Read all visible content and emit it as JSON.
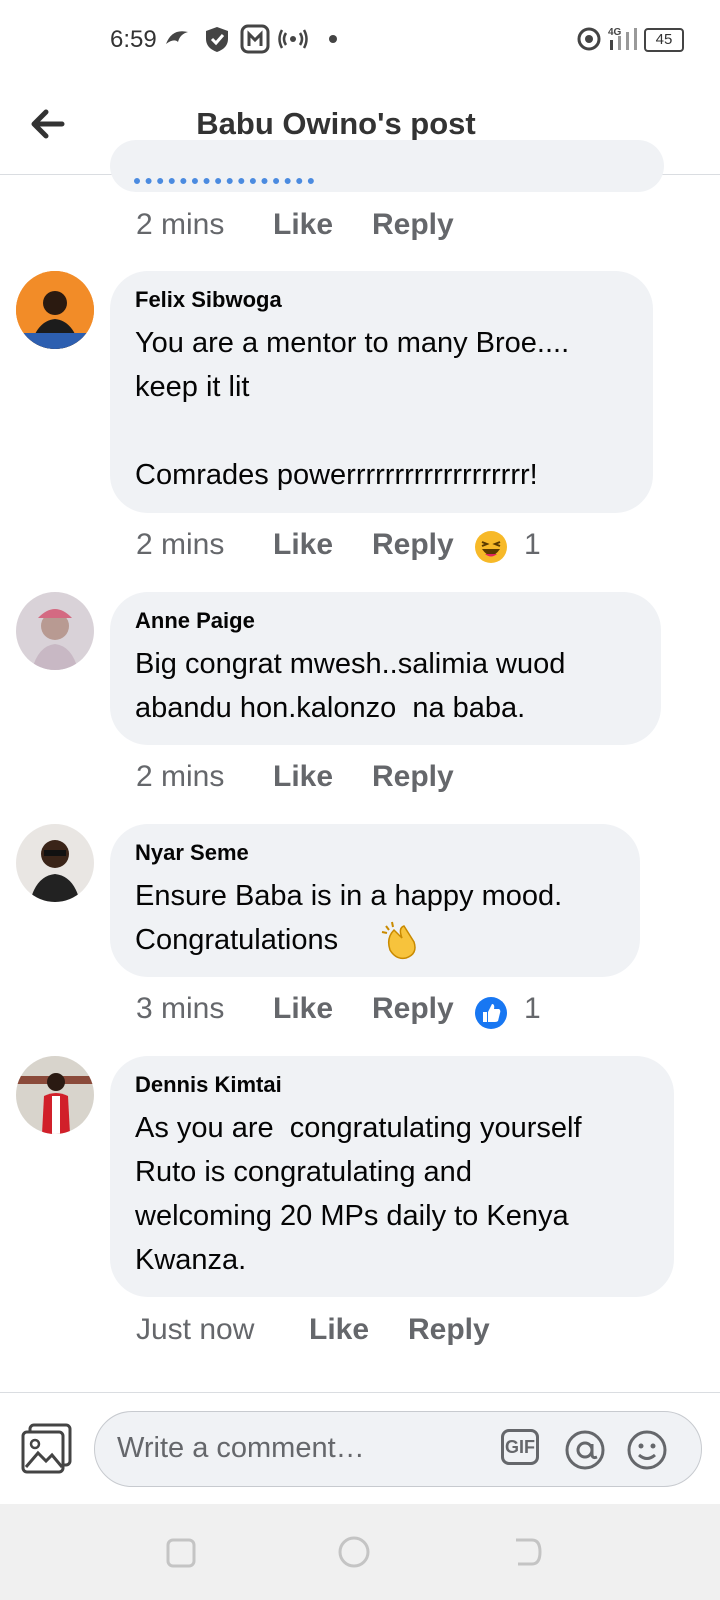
{
  "status_bar": {
    "time": "6:59",
    "battery": "45",
    "network": "4G"
  },
  "header": {
    "title": "Babu Owino's post"
  },
  "previous_comment": {
    "time": "2 mins",
    "like": "Like",
    "reply": "Reply"
  },
  "comments": [
    {
      "name": "Felix Sibwoga",
      "text": "You are a mentor to many Broe....\nkeep it lit\n\nComrades powerrrrrrrrrrrrrrrrrrr!",
      "time": "2 mins",
      "like": "Like",
      "reply": "Reply",
      "reaction": "laughing-emoji",
      "reaction_count": "1"
    },
    {
      "name": "Anne Paige",
      "text": "Big congrat mwesh..salimia wuod\nabandu hon.kalonzo  na baba.",
      "time": "2 mins",
      "like": "Like",
      "reply": "Reply"
    },
    {
      "name": "Nyar Seme",
      "text": "Ensure Baba is in a happy mood.\nCongratulations",
      "time": "3 mins",
      "like": "Like",
      "reply": "Reply",
      "reaction": "like-thumb",
      "reaction_count": "1"
    },
    {
      "name": "Dennis Kimtai",
      "text": "As you are  congratulating yourself\nRuto is congratulating and\nwelcoming 20 MPs daily to Kenya\nKwanza.",
      "time": "Just now",
      "like": "Like",
      "reply": "Reply"
    }
  ],
  "composer": {
    "placeholder": "Write a comment…",
    "gif_label": "GIF"
  },
  "colors": {
    "bubble": "#f0f2f5",
    "meta_text": "#65676b",
    "like_blue": "#1877f2",
    "laugh_yellow": "#f7b928"
  }
}
